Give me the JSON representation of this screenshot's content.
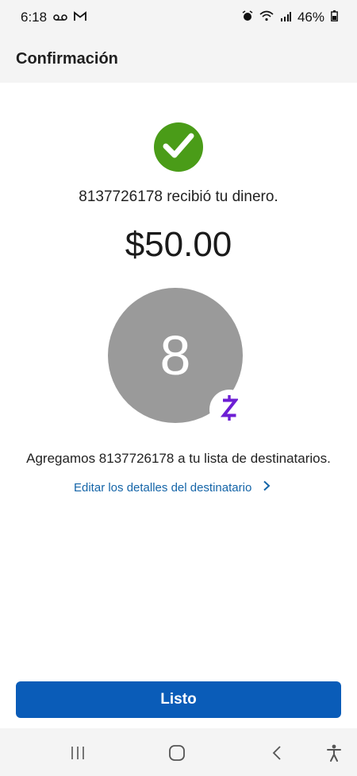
{
  "status_bar": {
    "time": "6:18",
    "battery": "46%"
  },
  "header": {
    "title": "Confirmación"
  },
  "confirmation": {
    "message": "8137726178 recibió tu dinero.",
    "amount": "$50.00"
  },
  "recipient": {
    "avatar_initial": "8"
  },
  "added_note": "Agregamos 8137726178 a tu lista de destinatarios.",
  "edit_link": "Editar los detalles del destinatario",
  "done_button": "Listo",
  "colors": {
    "success": "#4a9c18",
    "primary": "#0a5cb8",
    "zelle": "#6d1ed4",
    "link": "#1565a8"
  },
  "icons": [
    "voicemail-icon",
    "gmail-icon",
    "alarm-icon",
    "wifi-icon",
    "signal-icon",
    "battery-icon",
    "check-icon",
    "zelle-icon",
    "chevron-right-icon",
    "recents-icon",
    "home-icon",
    "back-icon",
    "accessibility-icon"
  ]
}
